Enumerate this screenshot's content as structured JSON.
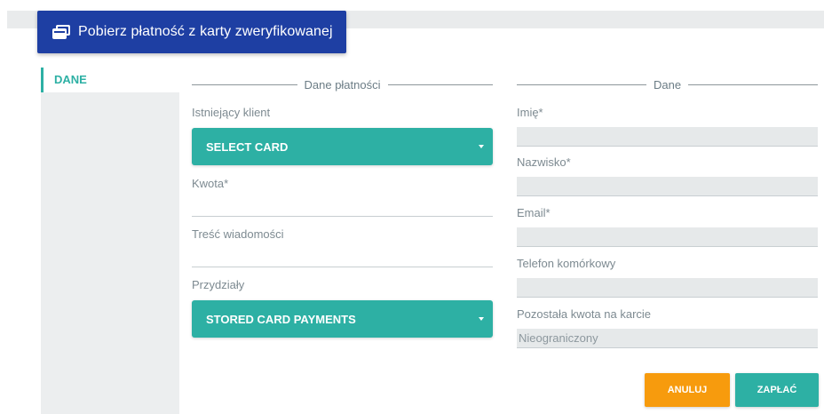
{
  "header": {
    "title": "Pobierz płatność z karty zweryfikowanej",
    "icon": "payment-card-icon"
  },
  "sidebar": {
    "tabs": [
      {
        "label": "DANE",
        "active": true
      }
    ]
  },
  "payment_section": {
    "title": "Dane płatności",
    "existing_client_label": "Istniejący klient",
    "select_card_value": "SELECT CARD",
    "amount_label": "Kwota*",
    "amount_value": "",
    "message_label": "Treść wiadomości",
    "message_value": "",
    "assignments_label": "Przydziały",
    "assignments_value": "STORED CARD PAYMENTS"
  },
  "data_section": {
    "title": "Dane",
    "first_name_label": "Imię*",
    "last_name_label": "Nazwisko*",
    "email_label": "Email*",
    "phone_label": "Telefon komórkowy",
    "remaining_label": "Pozostała kwota na karcie",
    "remaining_value": "Nieograniczony"
  },
  "buttons": {
    "cancel": "ANULUJ",
    "pay": "ZAPŁAĆ"
  },
  "colors": {
    "brand_blue": "#1e3fa3",
    "teal": "#2db0a4",
    "orange": "#f79b0d"
  }
}
